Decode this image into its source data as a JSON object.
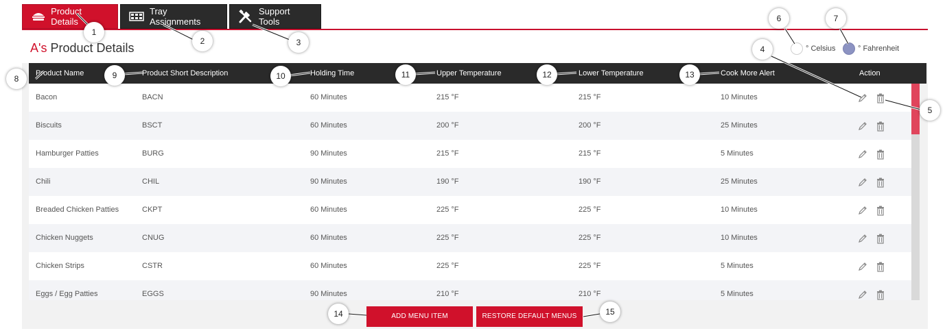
{
  "tabs": [
    {
      "label": "Product Details",
      "icon": "burger-icon"
    },
    {
      "label": "Tray Assignments",
      "icon": "tray-icon"
    },
    {
      "label": "Support Tools",
      "icon": "tools-icon"
    }
  ],
  "page_title": {
    "brand": "A's",
    "text": "Product Details"
  },
  "temperature": {
    "celsius_label": "° Celsius",
    "fahrenheit_label": "° Fahrenheit",
    "selected": "fahrenheit"
  },
  "table": {
    "columns": [
      "Product Name",
      "Product Short Description",
      "Holding Time",
      "Upper Temperature",
      "Lower Temperature",
      "Cook More Alert",
      "Action"
    ],
    "rows": [
      {
        "name": "Bacon",
        "short": "BACN",
        "holding": "60 Minutes",
        "upper": "215 °F",
        "lower": "215 °F",
        "alert": "10 Minutes"
      },
      {
        "name": "Biscuits",
        "short": "BSCT",
        "holding": "60 Minutes",
        "upper": "200 °F",
        "lower": "200 °F",
        "alert": "25 Minutes"
      },
      {
        "name": "Hamburger Patties",
        "short": "BURG",
        "holding": "90 Minutes",
        "upper": "215 °F",
        "lower": "215 °F",
        "alert": "5 Minutes"
      },
      {
        "name": "Chili",
        "short": "CHIL",
        "holding": "90 Minutes",
        "upper": "190 °F",
        "lower": "190 °F",
        "alert": "25 Minutes"
      },
      {
        "name": "Breaded Chicken Patties",
        "short": "CKPT",
        "holding": "60 Minutes",
        "upper": "225 °F",
        "lower": "225 °F",
        "alert": "10 Minutes"
      },
      {
        "name": "Chicken Nuggets",
        "short": "CNUG",
        "holding": "60 Minutes",
        "upper": "225 °F",
        "lower": "225 °F",
        "alert": "10 Minutes"
      },
      {
        "name": "Chicken Strips",
        "short": "CSTR",
        "holding": "60 Minutes",
        "upper": "225 °F",
        "lower": "225 °F",
        "alert": "5 Minutes"
      },
      {
        "name": "Eggs / Egg Patties",
        "short": "EGGS",
        "holding": "90 Minutes",
        "upper": "210 °F",
        "lower": "210 °F",
        "alert": "5 Minutes"
      }
    ],
    "action_icons": [
      "pencil-icon",
      "trash-icon"
    ]
  },
  "buttons": {
    "add": "ADD MENU ITEM",
    "restore": "RESTORE DEFAULT MENUS"
  },
  "callouts": [
    "1",
    "2",
    "3",
    "4",
    "5",
    "6",
    "7",
    "8",
    "9",
    "10",
    "11",
    "12",
    "13",
    "14",
    "15"
  ],
  "colors": {
    "accent": "#d0112b",
    "header": "#2a2a2a",
    "radio_selected": "#8c93c2"
  }
}
